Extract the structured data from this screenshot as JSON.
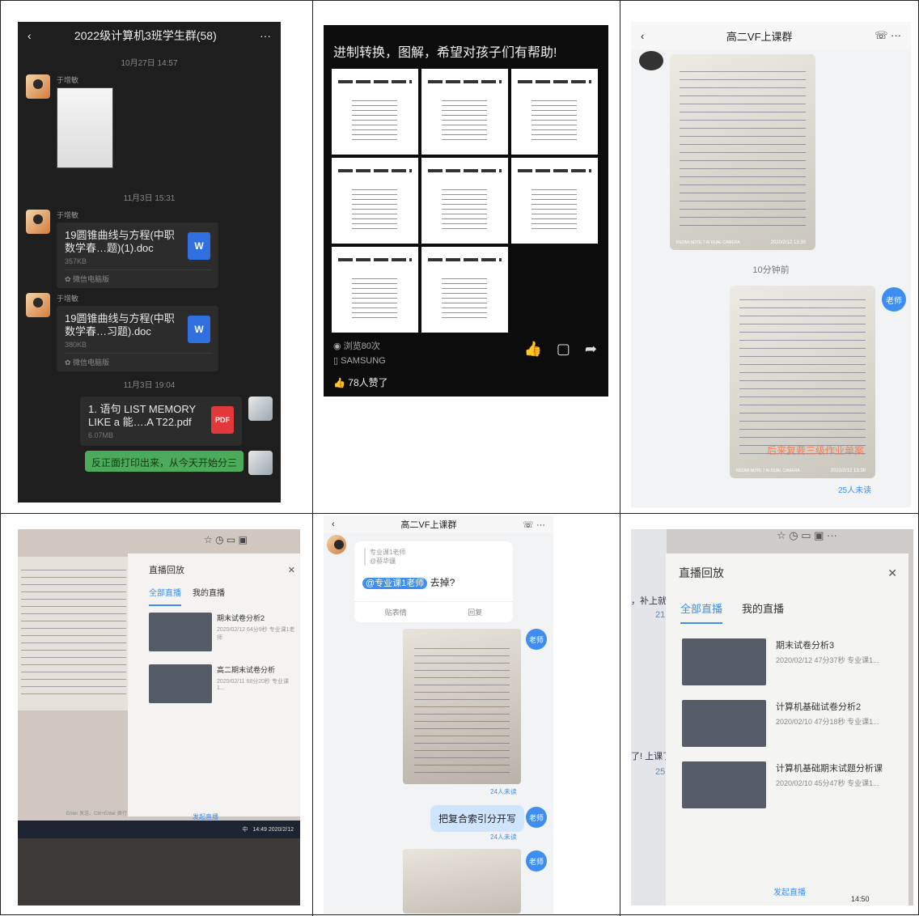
{
  "cell1": {
    "title": "2022级计算机3班学生群(58)",
    "more": "···",
    "back": "‹",
    "times": [
      "10月27日 14:57",
      "11月3日 15:31",
      "11月3日 19:04"
    ],
    "sender": "于增敏",
    "files": [
      {
        "name": "19圆锥曲线与方程(中职数学春…题)(1).doc",
        "size": "357KB",
        "source": "微信电脑版",
        "type": "W"
      },
      {
        "name": "19圆锥曲线与方程(中职数学春…习题).doc",
        "size": "380KB",
        "source": "微信电脑版",
        "type": "W"
      }
    ],
    "pdf": {
      "name": "1. 语句 LIST MEMORY LIKE a 能….A T22.pdf",
      "size": "6.07MB",
      "type": "PDF"
    },
    "green_msg": "反正面打印出来，从今天开始分三"
  },
  "cell2": {
    "title": "进制转换，图解，希望对孩子们有帮助!",
    "views": "浏览80次",
    "device": "SAMSUNG",
    "likes": "78人赞了"
  },
  "cell3": {
    "title": "高二VF上课群",
    "time": "10分钟前",
    "teacher": "老师",
    "unread": "25人未读",
    "photo_note": "后来复要三级作业单案",
    "photo_date1": "2020/2/12 13:39",
    "photo_date2": "2020/2/12 13:39",
    "photo_stamp": "REDMI NOTE 7 AI DUAL CAMERA"
  },
  "cell4": {
    "panel_title": "直播回放",
    "tab_all": "全部直播",
    "tab_mine": "我的直播",
    "items": [
      {
        "name": "期末试卷分析2",
        "meta": "2020/02/12 64分9秒 专业课1老师"
      },
      {
        "name": "高二期末试卷分析",
        "meta": "2020/02/11 68分20秒 专业课1..."
      }
    ],
    "send_live": "发起直播",
    "enter_tip": "Enter 发送，Ctrl+Enter 换行",
    "clock_time": "14:49",
    "clock_date": "2020/2/12",
    "ime": "中"
  },
  "cell5": {
    "title": "高二VF上课群",
    "quote": [
      "专业课1老师",
      "@蔡华疆"
    ],
    "mention": "@专业课1老师",
    "mention_rest": "去掉?",
    "emoji_btn": "贴表情",
    "reply_btn": "回复",
    "teacher": "老师",
    "unread1": "24人未读",
    "unread2": "24人未读",
    "bubble": "把复合索引分开写"
  },
  "cell6": {
    "panel_title": "直播回放",
    "tab_all": "全部直播",
    "tab_mine": "我的直播",
    "items": [
      {
        "name": "期末试卷分析3",
        "meta": "2020/02/12 47分37秒 专业课1..."
      },
      {
        "name": "计算机基础试卷分析2",
        "meta": "2020/02/10 47分18秒 专业课1..."
      },
      {
        "name": "计算机基础期末试题分析课",
        "meta": "2020/02/10 45分47秒 专业课1..."
      }
    ],
    "send_live": "发起直播",
    "side1": "，补上就",
    "side2": "了! 上课了",
    "side_num1": "21",
    "side_num2": "25",
    "clock": "14:50"
  }
}
